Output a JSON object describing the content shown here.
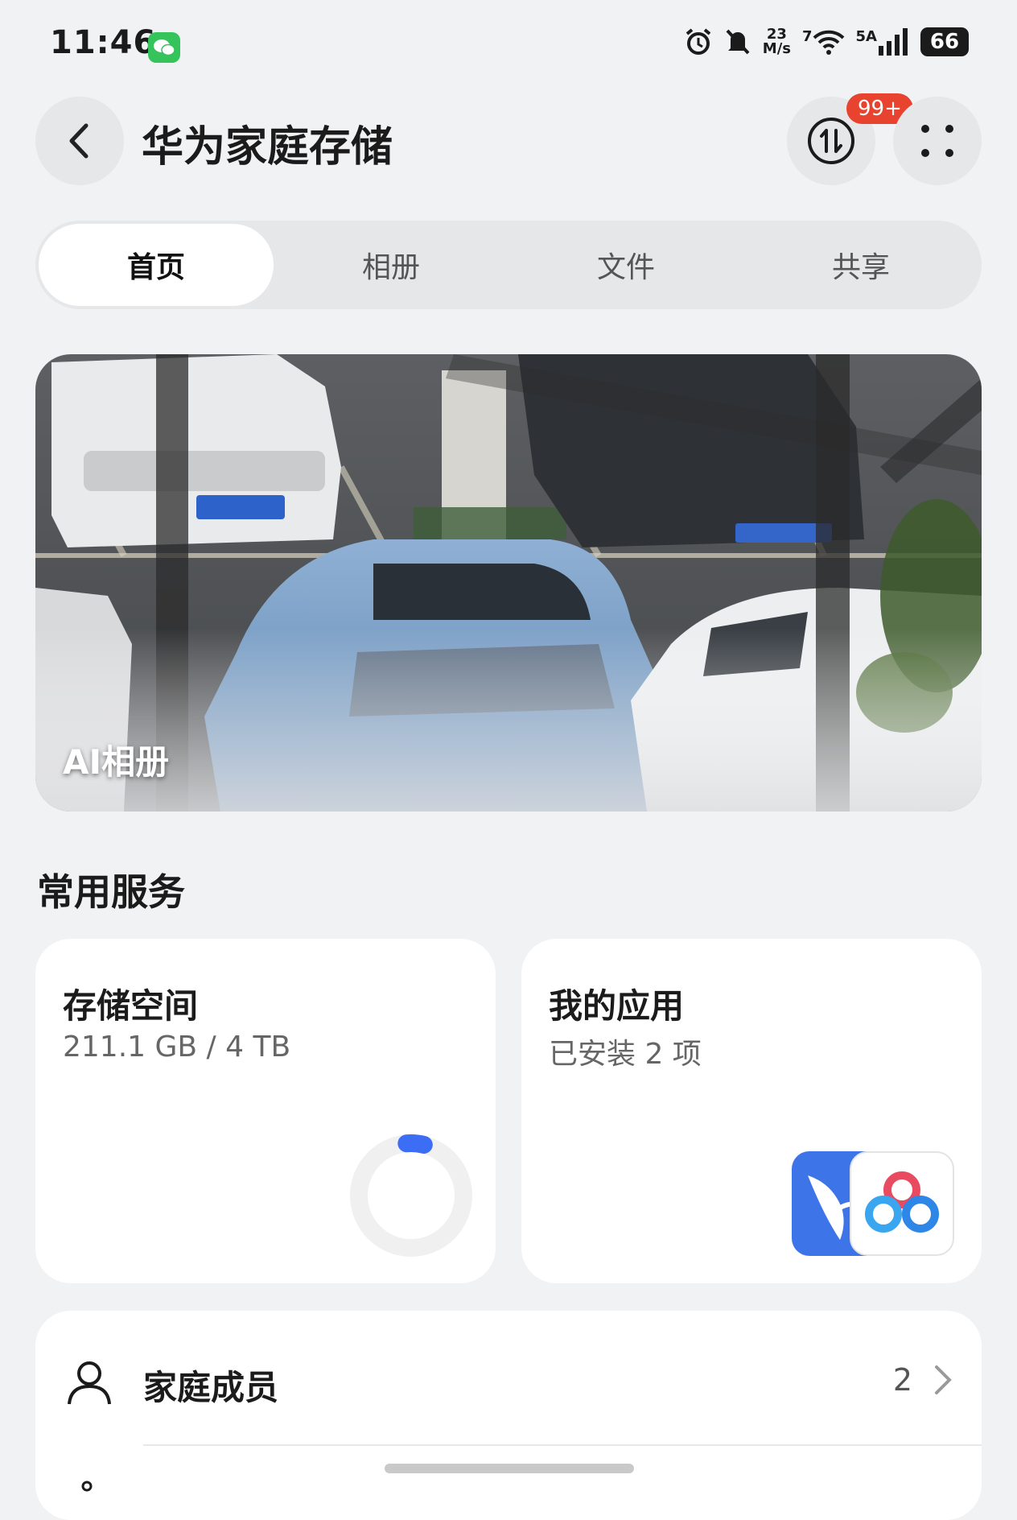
{
  "status_bar": {
    "time": "11:46",
    "net_speed_value": "23",
    "net_speed_unit": "M/s",
    "wifi_label": "7",
    "signal_label": "5A",
    "battery": "66"
  },
  "header": {
    "title": "华为家庭存储",
    "badge": "99+"
  },
  "tabs": [
    {
      "label": "首页",
      "active": true
    },
    {
      "label": "相册",
      "active": false
    },
    {
      "label": "文件",
      "active": false
    },
    {
      "label": "共享",
      "active": false
    }
  ],
  "photo_card": {
    "label": "AI相册"
  },
  "services": {
    "section_title": "常用服务",
    "storage": {
      "title": "存储空间",
      "usage": "211.1 GB / 4 TB",
      "used_fraction": 0.053
    },
    "apps": {
      "title": "我的应用",
      "installed": "已安装 2 项",
      "icons": [
        "petal-app-icon",
        "baidu-netdisk-icon"
      ]
    }
  },
  "family": {
    "label": "家庭成员",
    "count": "2"
  },
  "colors": {
    "background": "#f1f2f4",
    "badge": "#e8432e",
    "accent_blue": "#3b6df5"
  }
}
